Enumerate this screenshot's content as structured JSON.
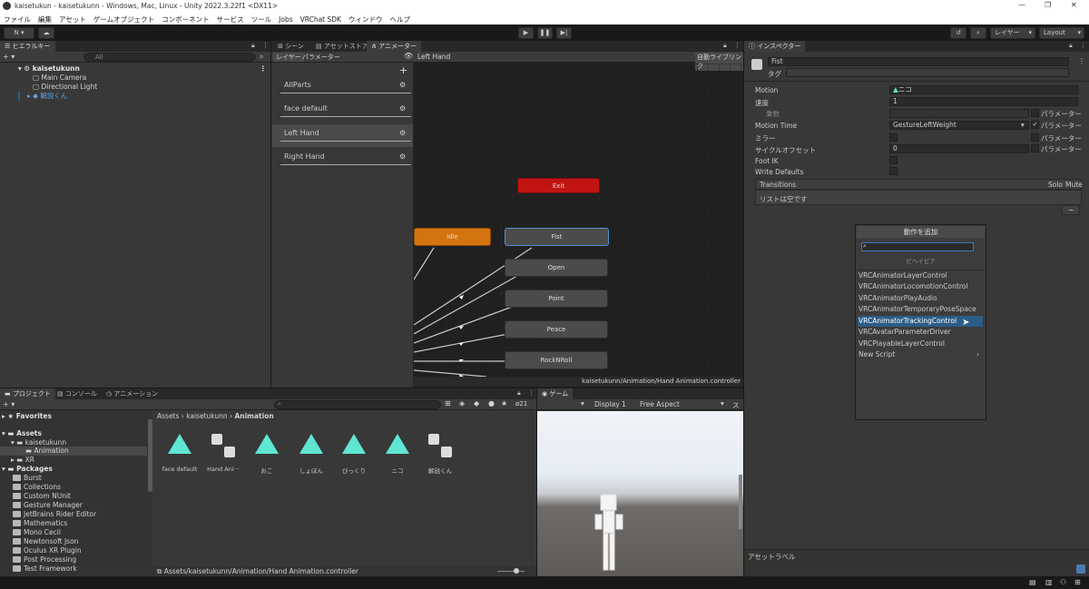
{
  "window": {
    "title": "kaisetukun - kaisetukunn - Windows, Mac, Linux - Unity 2022.3.22f1 <DX11>",
    "minimize": "—",
    "maximize": "❐",
    "close": "✕"
  },
  "menu": [
    "ファイル",
    "編集",
    "アセット",
    "ゲームオブジェクト",
    "コンポーネント",
    "サービス",
    "ツール",
    "Jobs",
    "VRChat SDK",
    "ウィンドウ",
    "ヘルプ"
  ],
  "toolbar": {
    "account": "N ▾",
    "layers": "レイヤー",
    "layout": "Layout"
  },
  "hierarchy": {
    "tab": "ヒエラルキー",
    "search_placeholder": "All",
    "add": "+ ▾",
    "scene": "kaisetukunn",
    "items": [
      "Main Camera",
      "Directional Light",
      "解説くん"
    ]
  },
  "animator": {
    "tabs": [
      "シーン",
      "アセットストア",
      "アニメーター"
    ],
    "sub_tabs": [
      "レイヤー",
      "パラメーター"
    ],
    "breadcrumb": "Left Hand",
    "auto_live": "自動ライブリンク",
    "layers": [
      "AllParts",
      "face default",
      "Left Hand",
      "Right Hand"
    ],
    "nodes": {
      "exit": "Exit",
      "idle": "Idle",
      "fist": "Fist",
      "open": "Open",
      "point": "Point",
      "peace": "Peace",
      "rocknroll": "RockNRoll"
    },
    "status": "kaisetukunn/Animation/Hand Animation.controller"
  },
  "inspector": {
    "tab": "インスペクター",
    "name": "Fist",
    "tag_label": "タグ",
    "motion_label": "Motion",
    "motion_value": "ニコ",
    "speed_label": "速度",
    "speed_value": "1",
    "multiplier_label": "乗数",
    "param_label": "パラメーター",
    "motion_time_label": "Motion Time",
    "motion_time_value": "GestureLeftWeight",
    "mirror_label": "ミラー",
    "cycle_label": "サイクルオフセット",
    "cycle_value": "0",
    "footik_label": "Foot IK",
    "writedef_label": "Write Defaults",
    "transitions_label": "Transitions",
    "solo": "Solo",
    "mute": "Mute",
    "empty_list": "リストは空です",
    "minus": "−",
    "asset_label": "アセットラベル"
  },
  "add_component": {
    "title": "動作を追加",
    "section": "ビヘイビア",
    "items": [
      "VRCAnimatorLayerControl",
      "VRCAnimatorLocomotionControl",
      "VRCAnimatorPlayAudio",
      "VRCAnimatorTemporaryPoseSpace",
      "VRCAnimatorTrackingControl",
      "VRCAvatarParameterDriver",
      "VRCPlayableLayerControl",
      "New Script"
    ],
    "selected_index": 4,
    "submenu_arrow": "›"
  },
  "project": {
    "tabs": [
      "プロジェクト",
      "コンソール",
      "アニメーション"
    ],
    "favorites": "Favorites",
    "assets": "Assets",
    "folders": [
      "kaisetukunn",
      "Animation",
      "XR"
    ],
    "packages_label": "Packages",
    "packages": [
      "Burst",
      "Collections",
      "Custom NUnit",
      "Gesture Manager",
      "JetBrains Rider Editor",
      "Mathematics",
      "Mono Cecil",
      "Newtonsoft Json",
      "Oculus XR Plugin",
      "Post Processing",
      "Test Framework"
    ],
    "breadcrumb_a": "Assets",
    "breadcrumb_b": "kaisetukunn",
    "breadcrumb_c": "Animation",
    "asset_items": [
      {
        "name": "face default",
        "kind": "anim"
      },
      {
        "name": "Hand Ani···",
        "kind": "controller"
      },
      {
        "name": "おこ",
        "kind": "anim"
      },
      {
        "name": "しょぼん",
        "kind": "anim"
      },
      {
        "name": "びっくり",
        "kind": "anim"
      },
      {
        "name": "ニコ",
        "kind": "anim"
      },
      {
        "name": "解説くん",
        "kind": "controller"
      }
    ],
    "footer_path": "Assets/kaisetukunn/Animation/Hand Animation.controller",
    "count": "21"
  },
  "game": {
    "tab": "ゲーム",
    "display": "Display 1",
    "aspect": "Free Aspect",
    "scale": "スケ"
  },
  "colors": {
    "accent_selection": "#2c5d87",
    "node_orange": "#d3740e",
    "node_red": "#c21313",
    "game_sky": "#e8eef6",
    "game_ground": "#5d5a57",
    "asset_anim": "#5fe6d2"
  }
}
